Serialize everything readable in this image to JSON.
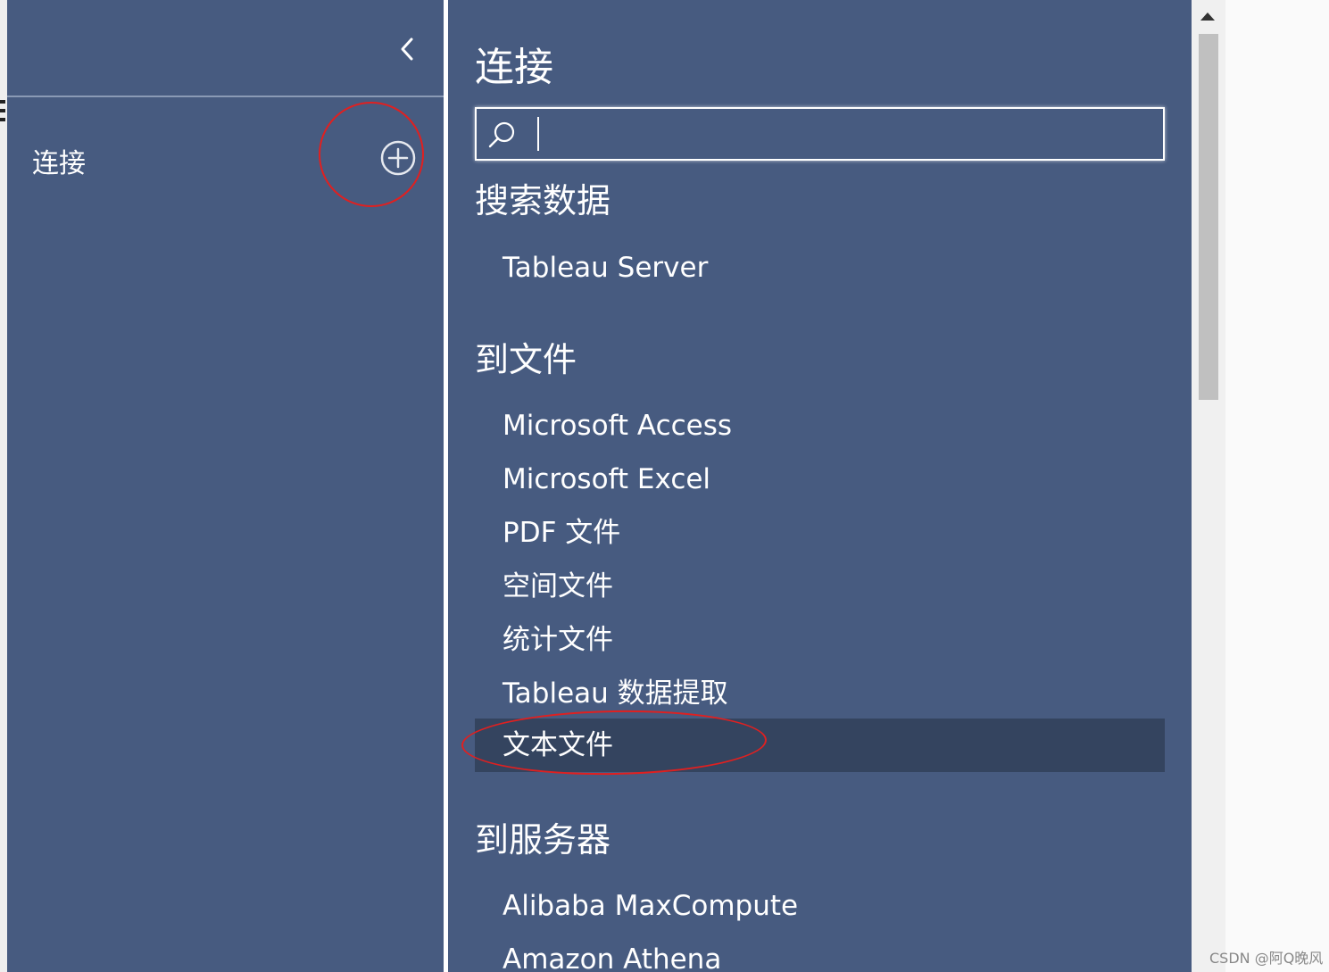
{
  "left_panel": {
    "title": "连接",
    "collapse_icon": "chevron-left-icon",
    "add_icon": "plus-circle-icon"
  },
  "main": {
    "title": "连接",
    "search": {
      "placeholder": "",
      "value": "",
      "icon": "search-icon"
    },
    "sections": {
      "search_data": {
        "title": "搜索数据",
        "items": [
          "Tableau Server"
        ]
      },
      "to_file": {
        "title": "到文件",
        "items": [
          "Microsoft Access",
          "Microsoft Excel",
          "PDF 文件",
          "空间文件",
          "统计文件",
          "Tableau 数据提取",
          "文本文件"
        ],
        "selected": "文本文件"
      },
      "to_server": {
        "title": "到服务器",
        "items": [
          "Alibaba MaxCompute",
          "Amazon Athena"
        ]
      }
    }
  },
  "watermark": "CSDN @阿Q晚风",
  "colors": {
    "panel_bg": "#475b80",
    "selected_bg": "#34445f",
    "annotation": "#e02020",
    "text": "#ffffff"
  }
}
